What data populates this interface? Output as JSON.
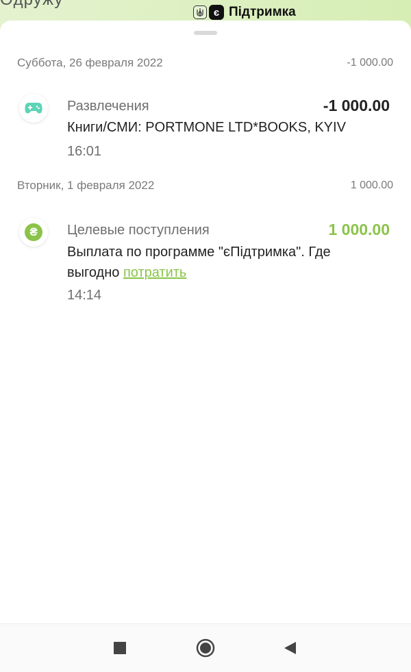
{
  "status": {
    "partial_text": "Oдружу",
    "brand_badge": "є",
    "brand_name": "Підтримка"
  },
  "groups": [
    {
      "date": "Суббота, 26 февраля 2022",
      "total": "-1 000.00",
      "transactions": [
        {
          "icon": "gamepad-icon",
          "category": "Развлечения",
          "amount": "-1 000.00",
          "description": "Книги/СМИ: PORTMONE LTD*BOOKS, KYIV",
          "time": "16:01"
        }
      ]
    },
    {
      "date": "Вторник, 1 февраля 2022",
      "total": "1 000.00",
      "transactions": [
        {
          "icon": "hryvnia-icon",
          "icon_glyph": "₴",
          "category": "Целевые поступления",
          "amount": "1 000.00",
          "description": "Выплата по программе \"єПідтримка\". Где выгодно",
          "link": "потратить",
          "time": "14:14"
        }
      ]
    }
  ],
  "colors": {
    "accent_green": "#8bc34a",
    "gamepad_teal": "#5dd4b8"
  },
  "nav": {
    "recents": "recents-icon",
    "home": "home-icon",
    "back": "back-icon"
  }
}
